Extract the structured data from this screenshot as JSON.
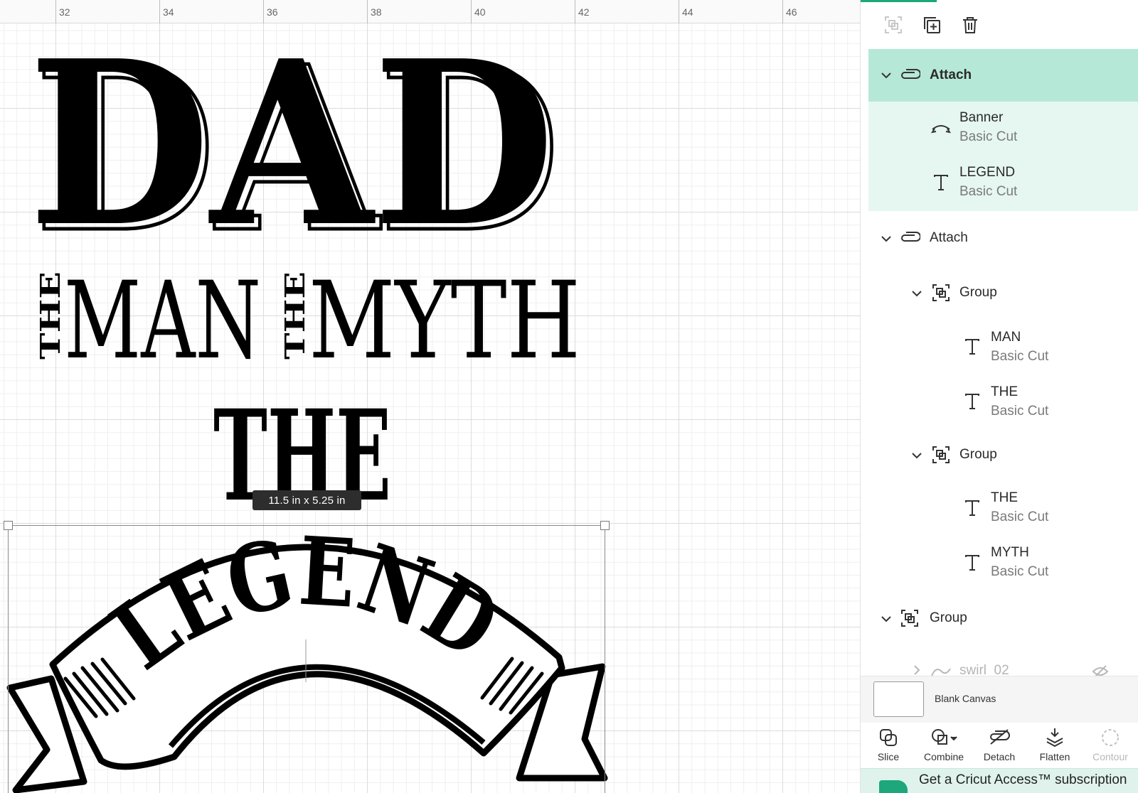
{
  "ruler": {
    "numbers": [
      "32",
      "34",
      "36",
      "38",
      "40",
      "42",
      "44",
      "46"
    ]
  },
  "canvas": {
    "art": {
      "dad": "DAD",
      "the_left": "THE",
      "man": "MAN",
      "the_mid": "THE",
      "myth": "MYTH",
      "the_big": "THE",
      "legend": "LEGEND"
    },
    "size_badge": "11.5  in x 5.25  in"
  },
  "toolbar": {
    "buttons": [
      {
        "name": "group-icon",
        "disabled": true
      },
      {
        "name": "duplicate-icon",
        "disabled": false
      },
      {
        "name": "delete-icon",
        "disabled": false
      }
    ]
  },
  "layers": {
    "attach_1": {
      "label": "Attach"
    },
    "banner": {
      "label": "Banner",
      "sub": "Basic Cut"
    },
    "legend": {
      "label": "LEGEND",
      "sub": "Basic Cut"
    },
    "attach_2": {
      "label": "Attach"
    },
    "group_1": {
      "label": "Group"
    },
    "man": {
      "label": "MAN",
      "sub": "Basic Cut"
    },
    "the_1": {
      "label": "THE",
      "sub": "Basic Cut"
    },
    "group_2": {
      "label": "Group"
    },
    "the_2": {
      "label": "THE",
      "sub": "Basic Cut"
    },
    "myth": {
      "label": "MYTH",
      "sub": "Basic Cut"
    },
    "group_3": {
      "label": "Group"
    },
    "swirl": {
      "label": "swirl_02"
    }
  },
  "blank_canvas": {
    "label": "Blank Canvas"
  },
  "actions": {
    "slice": "Slice",
    "combine": "Combine",
    "detach": "Detach",
    "flatten": "Flatten",
    "contour": "Contour"
  },
  "promo": {
    "text": "Get a Cricut Access™ subscription"
  },
  "colors": {
    "accent": "#1ea77a",
    "highlight_strong": "#b6e8d8",
    "highlight_light": "#e6f7f1"
  }
}
